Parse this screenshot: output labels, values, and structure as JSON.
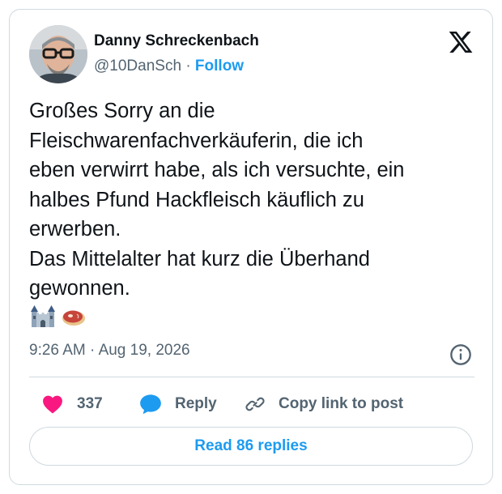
{
  "author": {
    "name": "Danny Schreckenbach",
    "handle": "@10DanSch",
    "separator": "·",
    "follow_label": "Follow"
  },
  "tweet": {
    "text": "Großes Sorry an die\nFleischwarenfachverkäuferin, die ich\neben verwirrt habe, als ich versuchte, ein\nhalbes Pfund Hackfleisch käuflich zu\nerwerben.\nDas Mittelalter hat kurz die Überhand\ngewonnen.",
    "emojis": [
      "castle-emoji",
      "meat-emoji"
    ],
    "time": "9:26 AM",
    "meta_separator": "·",
    "date": "Aug 19, 2026"
  },
  "actions": {
    "like_count": "337",
    "reply_label": "Reply",
    "copy_label": "Copy link to post"
  },
  "footer": {
    "read_replies_label": "Read 86 replies"
  },
  "colors": {
    "accent": "#1d9bf0",
    "like": "#f91880",
    "text": "#0f1419",
    "muted": "#536471",
    "border": "#cfd9de"
  },
  "icons": [
    "x-logo-icon",
    "info-icon",
    "heart-icon",
    "reply-bubble-icon",
    "link-icon"
  ]
}
